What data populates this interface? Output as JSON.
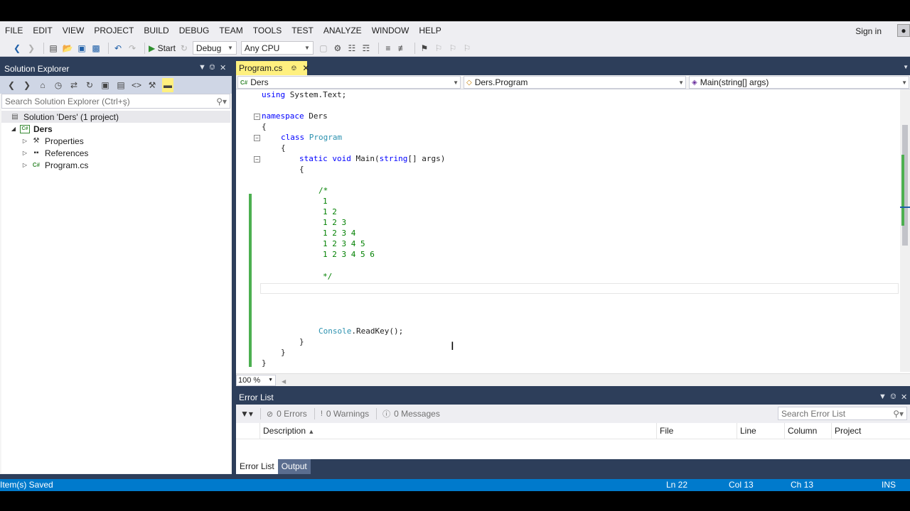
{
  "menu": [
    "FILE",
    "EDIT",
    "VIEW",
    "PROJECT",
    "BUILD",
    "DEBUG",
    "TEAM",
    "TOOLS",
    "TEST",
    "ANALYZE",
    "WINDOW",
    "HELP"
  ],
  "account": {
    "signin_label": "Sign in"
  },
  "toolbar": {
    "start_label": "Start",
    "config_value": "Debug",
    "platform_value": "Any CPU"
  },
  "solution_explorer": {
    "title": "Solution Explorer",
    "search_placeholder": "Search Solution Explorer (Ctrl+ş)",
    "tree": [
      {
        "label": "Solution 'Ders' (1 project)",
        "icon": "solution-icon"
      },
      {
        "label": "Ders",
        "icon": "csharp-project-icon"
      },
      {
        "label": "Properties",
        "icon": "wrench-icon"
      },
      {
        "label": "References",
        "icon": "references-icon"
      },
      {
        "label": "Program.cs",
        "icon": "csharp-file-icon"
      }
    ]
  },
  "editor": {
    "tab_label": "Program.cs",
    "nav_project": "Ders",
    "nav_class": "Ders.Program",
    "nav_member": "Main(string[] args)",
    "zoom": "100 %",
    "code": {
      "l1": "System.Text;",
      "l1_kw": "using",
      "l2_kw": "namespace",
      "l2": "Ders",
      "brace_open": "{",
      "brace_close": "}",
      "l3_kw": "class",
      "l3_type": "Program",
      "l4_kw1": "static",
      "l4_kw2": "void",
      "l4_rest": "Main(",
      "l4_kw3": "string",
      "l4_end": "[] args)",
      "comment_open": "/*",
      "c1": "1",
      "c2": "1 2",
      "c3": "1 2 3",
      "c4": "1 2 3 4",
      "c5": "1 2 3 4 5",
      "c6": "1 2 3 4 5 6",
      "comment_close": "*/",
      "console_type": "Console",
      "console_rest": ".ReadKey();"
    }
  },
  "error_list": {
    "title": "Error List",
    "errors": "0 Errors",
    "warnings": "0 Warnings",
    "messages": "0 Messages",
    "search_placeholder": "Search Error List",
    "columns": [
      "Description",
      "File",
      "Line",
      "Column",
      "Project"
    ]
  },
  "bottom_tabs": [
    "Error List",
    "Output"
  ],
  "status": {
    "message": "Item(s) Saved",
    "ln": "Ln 22",
    "col": "Col 13",
    "ch": "Ch 13",
    "mode": "INS"
  }
}
